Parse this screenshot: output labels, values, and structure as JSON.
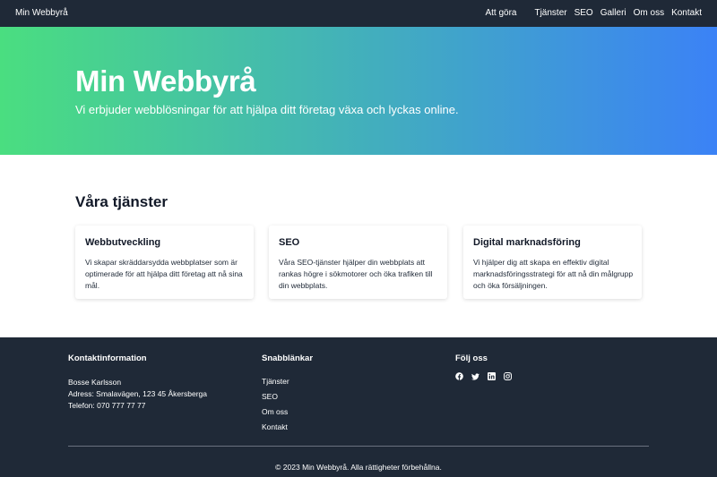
{
  "nav": {
    "brand": "Min Webbyrå",
    "links": [
      "Att göra",
      "Tjänster",
      "SEO",
      "Galleri",
      "Om oss",
      "Kontakt"
    ]
  },
  "hero": {
    "title": "Min Webbyrå",
    "subtitle": "Vi erbjuder webblösningar för att hjälpa ditt företag växa och lyckas online."
  },
  "services": {
    "heading": "Våra tjänster",
    "cards": [
      {
        "title": "Webbutveckling",
        "text": "Vi skapar skräddarsydda webbplatser som är optimerade för att hjälpa ditt företag att nå sina mål."
      },
      {
        "title": "SEO",
        "text": "Våra SEO-tjänster hjälper din webbplats att rankas högre i sökmotorer och öka trafiken till din webbplats."
      },
      {
        "title": "Digital marknadsföring",
        "text": "Vi hjälper dig att skapa en effektiv digital marknadsföringsstrategi för att nå din målgrupp och öka försäljningen."
      }
    ]
  },
  "footer": {
    "contact": {
      "heading": "Kontaktinformation",
      "name": "Bosse Karlsson",
      "address": "Adress: Smalavägen, 123 45 Åkersberga",
      "phone": "Telefon: 070 777 77 77"
    },
    "quicklinks": {
      "heading": "Snabblänkar",
      "links": [
        "Tjänster",
        "SEO",
        "Om oss",
        "Kontakt"
      ]
    },
    "follow": {
      "heading": "Följ oss",
      "icons": [
        "facebook-icon",
        "twitter-icon",
        "linkedin-icon",
        "instagram-icon"
      ]
    },
    "copyright": "© 2023 Min Webbyrå. Alla rättigheter förbehållna."
  },
  "colors": {
    "dark": "#1f2937",
    "gradient_start": "#4ade80",
    "gradient_end": "#3b82f6"
  }
}
